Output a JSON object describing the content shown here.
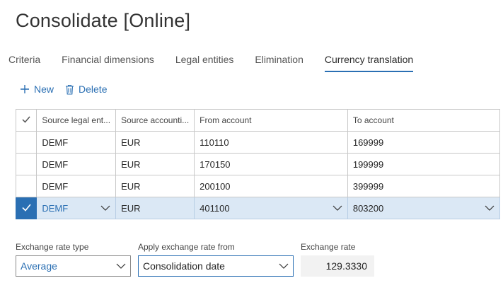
{
  "page": {
    "title": "Consolidate [Online]"
  },
  "tabs": [
    {
      "label": "Criteria",
      "active": false
    },
    {
      "label": "Financial dimensions",
      "active": false
    },
    {
      "label": "Legal entities",
      "active": false
    },
    {
      "label": "Elimination",
      "active": false
    },
    {
      "label": "Currency translation",
      "active": true
    }
  ],
  "actions": {
    "new_label": "New",
    "delete_label": "Delete"
  },
  "grid": {
    "columns": [
      "Source legal ent...",
      "Source accounti...",
      "From account",
      "To account"
    ],
    "rows": [
      {
        "entity": "DEMF",
        "currency": "EUR",
        "from": "110110",
        "to": "169999",
        "selected": false
      },
      {
        "entity": "DEMF",
        "currency": "EUR",
        "from": "170150",
        "to": "199999",
        "selected": false
      },
      {
        "entity": "DEMF",
        "currency": "EUR",
        "from": "200100",
        "to": "399999",
        "selected": false
      },
      {
        "entity": "DEMF",
        "currency": "EUR",
        "from": "401100",
        "to": "803200",
        "selected": true
      }
    ]
  },
  "form": {
    "exchange_rate_type": {
      "label": "Exchange rate type",
      "value": "Average"
    },
    "apply_from": {
      "label": "Apply exchange rate from",
      "value": "Consolidation date"
    },
    "exchange_rate": {
      "label": "Exchange rate",
      "value": "129.3330"
    }
  },
  "colors": {
    "accent": "#2a6fb3",
    "selected_row": "#dbe8f5"
  }
}
